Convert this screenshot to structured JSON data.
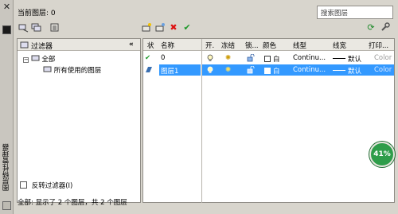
{
  "header": {
    "current_layer_label": "当前图层: 0",
    "search_placeholder": "搜索图层"
  },
  "sidebar": {
    "title": "图层特性管理器"
  },
  "filters": {
    "header_label": "过滤器",
    "items": [
      {
        "label": "全部"
      },
      {
        "label": "所有使用的图层"
      }
    ],
    "invert_label": "反转过滤器(I)"
  },
  "grid": {
    "columns": [
      "状",
      "名称",
      "开.",
      "冻结",
      "锁...",
      "颜色",
      "线型",
      "线宽",
      "打印..."
    ],
    "rows": [
      {
        "status": "✔",
        "name": "0",
        "color": "白",
        "linetype": "Continu...",
        "lineweight": "默认",
        "plot": "Color"
      },
      {
        "status": "▰",
        "name": "图层1",
        "color": "白",
        "linetype": "Continu...",
        "lineweight": "默认",
        "plot": "Color"
      }
    ]
  },
  "status_text": "全部: 显示了 2 个图层，共 2 个图层",
  "badge": {
    "value": "41%"
  },
  "colors": {
    "selected": "#3399ff",
    "badge": "#2e9d4a"
  }
}
